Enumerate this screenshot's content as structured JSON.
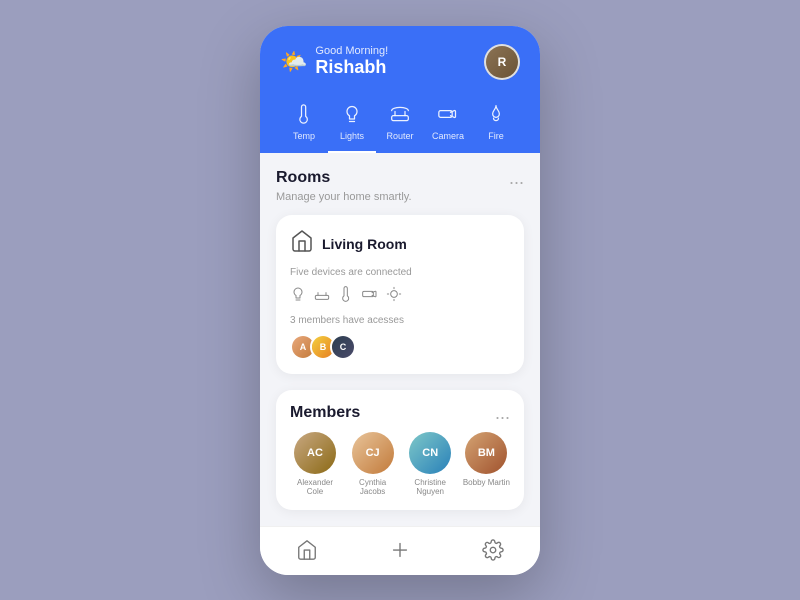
{
  "header": {
    "greeting": "Good Morning!",
    "username": "Rishabh",
    "weather_emoji": "🌤️"
  },
  "nav": {
    "tabs": [
      {
        "id": "temp",
        "label": "Temp"
      },
      {
        "id": "lights",
        "label": "Lights",
        "active": true
      },
      {
        "id": "router",
        "label": "Router"
      },
      {
        "id": "camera",
        "label": "Camera"
      },
      {
        "id": "fire",
        "label": "Fire"
      }
    ]
  },
  "rooms": {
    "title": "Rooms",
    "subtitle": "Manage your home smartly.",
    "more_label": "...",
    "room_card": {
      "name": "Living Room",
      "devices_text": "Five devices are connected",
      "members_text": "3 members have acesses",
      "members": [
        {
          "initials": "A",
          "color_class": "av1"
        },
        {
          "initials": "B",
          "color_class": "av2"
        },
        {
          "initials": "C",
          "color_class": "av3"
        }
      ]
    }
  },
  "members": {
    "title": "Members",
    "more_label": "...",
    "list": [
      {
        "name": "Alexander Cole",
        "initials": "AC",
        "color_class": "m1"
      },
      {
        "name": "Cynthia Jacobs",
        "initials": "CJ",
        "color_class": "m2"
      },
      {
        "name": "Christine Nguyen",
        "initials": "CN",
        "color_class": "m3"
      },
      {
        "name": "Bobby Martin",
        "initials": "BM",
        "color_class": "m4"
      }
    ]
  },
  "bottom_nav": {
    "items": [
      "home",
      "add",
      "settings"
    ]
  }
}
